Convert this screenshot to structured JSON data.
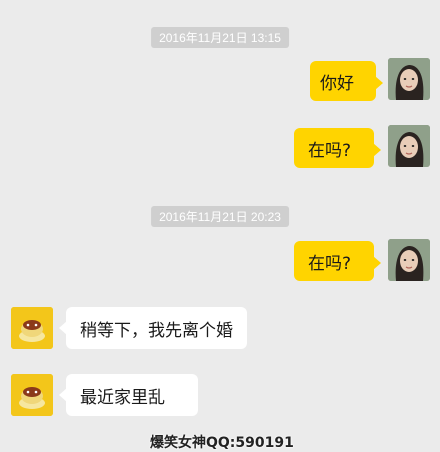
{
  "chat": {
    "timestamp_1": "2016年11月21日 13:15",
    "timestamp_2": "2016年11月21日 20:23",
    "messages": [
      {
        "side": "me",
        "text": "你好"
      },
      {
        "side": "me",
        "text": "在吗?"
      },
      {
        "side": "me",
        "text": "在吗?"
      },
      {
        "side": "other",
        "text": "稍等下，我先离个婚"
      },
      {
        "side": "other",
        "text": "最近家里乱"
      }
    ]
  },
  "watermark": "爆笑女神QQ:590191",
  "colors": {
    "background": "#ebebeb",
    "my_bubble": "#ffd400",
    "other_bubble": "#ffffff",
    "timestamp_bg": "#cfcfcf"
  },
  "icons": {
    "my_avatar": "girl-photo-avatar",
    "other_avatar": "pudding-emoji-avatar"
  }
}
